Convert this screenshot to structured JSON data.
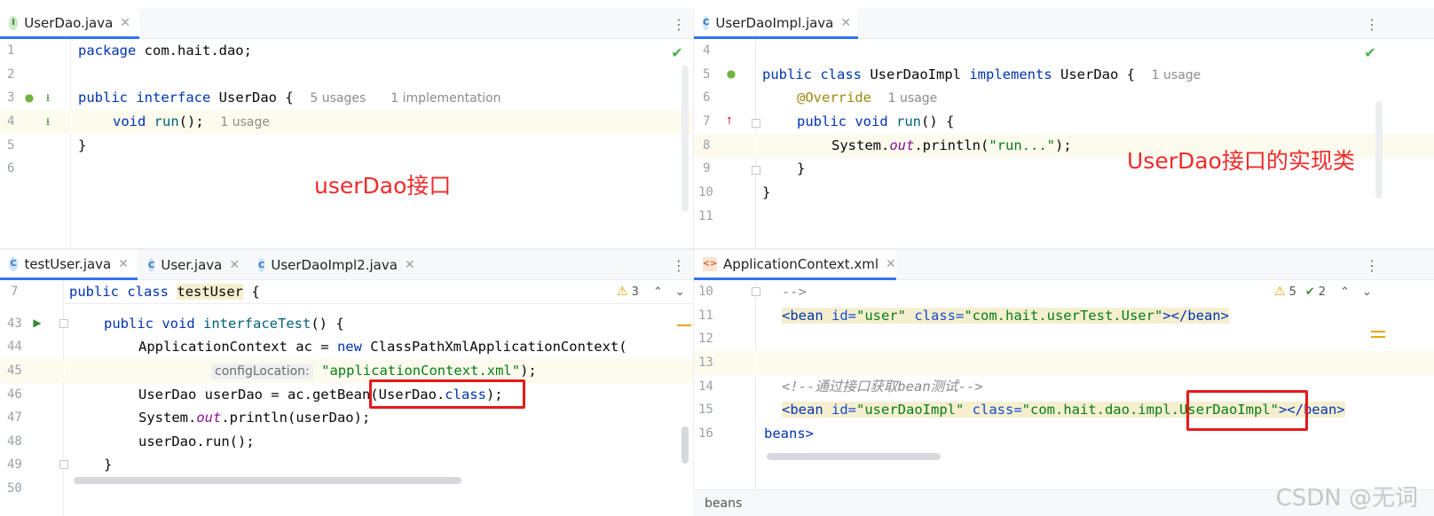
{
  "top_left": {
    "tab": "UserDao.java",
    "tab_icon": "I",
    "lines": [
      "1",
      "2",
      "3",
      "4",
      "5",
      "6"
    ],
    "code": {
      "l1_kw": "package",
      "l1_rest": " com.hait.dao;",
      "l3_kw1": "public",
      "l3_kw2": "interface",
      "l3_name": " UserDao {",
      "l3_hint1": "5 usages",
      "l3_hint2": "1 implementation",
      "l4_kw": "void",
      "l4_fn": "run",
      "l4_rest": "();",
      "l4_hint": "1 usage",
      "l5": "}"
    },
    "note": "userDao接口"
  },
  "top_right": {
    "tab": "UserDaoImpl.java",
    "tab_icon": "C",
    "lines": [
      "4",
      "5",
      "6",
      "7",
      "8",
      "9",
      "10",
      "11"
    ],
    "code": {
      "l5_kw1": "public",
      "l5_kw2": "class",
      "l5_name": " UserDaoImpl ",
      "l5_kw3": "implements",
      "l5_rest": " UserDao {",
      "l5_hint": "1 usage",
      "l6_ann": "@Override",
      "l6_hint": "1 usage",
      "l7_kw1": "public",
      "l7_kw2": "void",
      "l7_fn": "run",
      "l7_rest": "() {",
      "l8_a": "System.",
      "l8_out": "out",
      "l8_b": ".println(",
      "l8_str": "\"run...\"",
      "l8_c": ");",
      "l9": "}",
      "l10": "}"
    },
    "note": "UserDao接口的实现类"
  },
  "bottom_left": {
    "tabs": [
      {
        "label": "testUser.java",
        "icon": "C"
      },
      {
        "label": "User.java",
        "icon": "C"
      },
      {
        "label": "UserDaoImpl2.java",
        "icon": "C"
      }
    ],
    "warn_count": "3",
    "lines": [
      "7",
      "43",
      "44",
      "45",
      "46",
      "47",
      "48",
      "49",
      "50"
    ],
    "code": {
      "l7_kw1": "public",
      "l7_kw2": "class",
      "l7_name": "testUser",
      "l7_rest": " {",
      "l43_kw1": "public",
      "l43_kw2": "void",
      "l43_fn": "interfaceTest",
      "l43_rest": "() {",
      "l44_a": "ApplicationContext ac = ",
      "l44_kw": "new",
      "l44_b": " ClassPathXmlApplicationContext(",
      "l45_inlay": "configLocation:",
      "l45_str": "\"applicationContext.xml\"",
      "l45_rest": ");",
      "l46_a": "UserDao userDao = ac.getBean(UserDao.",
      "l46_kw": "class",
      "l46_rest": ");",
      "l47_a": "System.",
      "l47_out": "out",
      "l47_b": ".println(userDao);",
      "l48": "userDao.run();",
      "l49": "}"
    }
  },
  "bottom_right": {
    "tab": "ApplicationContext.xml",
    "warn_count": "5",
    "ok_count": "2",
    "lines": [
      "10",
      "11",
      "12",
      "13",
      "14",
      "15",
      "16"
    ],
    "code": {
      "l10": "-->",
      "l11_open": "<bean ",
      "l11_id_attr": "id=",
      "l11_id_val": "\"user\"",
      "l11_cls_attr": " class=",
      "l11_cls_val": "\"com.hait.userTest.User\"",
      "l11_close": "></bean>",
      "l14": "<!--通过接口获取bean测试-->",
      "l15_open": "<bean ",
      "l15_id_attr": "id=",
      "l15_id_val": "\"userDaoImpl\"",
      "l15_cls_attr": " class=",
      "l15_cls_val": "\"com.hait.dao.impl.UserDaoImpl\"",
      "l15_close": "></bean>",
      "l16": "beans>"
    },
    "status": "beans"
  },
  "watermark": "CSDN @无词"
}
